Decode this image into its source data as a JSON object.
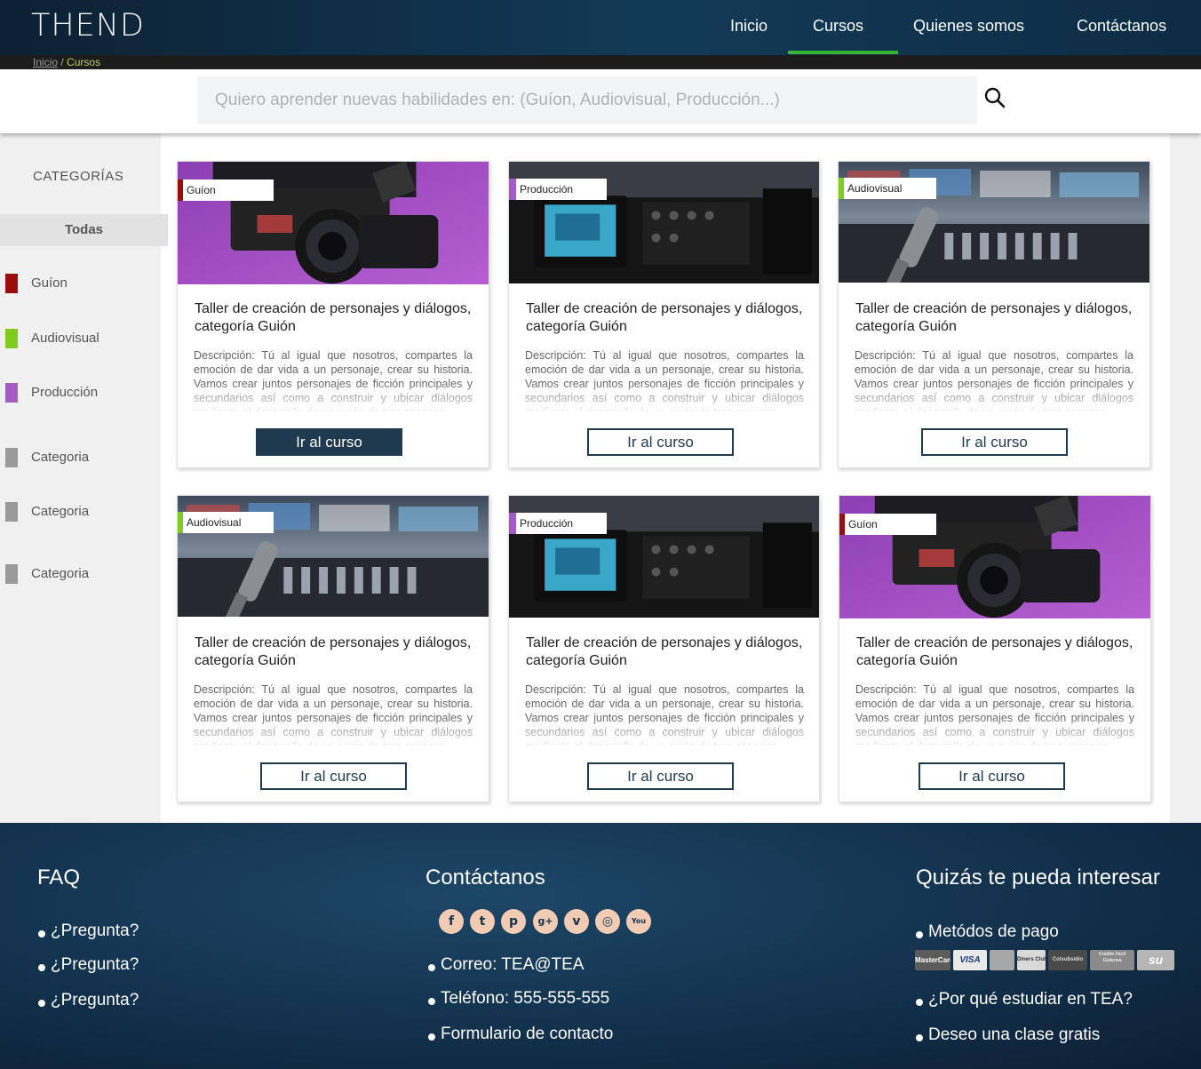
{
  "header": {
    "logo": "THEND",
    "nav": [
      "Inicio",
      "Cursos",
      "Quienes somos",
      "Contáctanos"
    ],
    "active_nav": "Cursos"
  },
  "breadcrumb": {
    "home": "Inicio",
    "separator": " / ",
    "current": "Cursos"
  },
  "search": {
    "placeholder": "Quiero aprender nuevas habilidades en: (Guíon, Audiovisual, Producción...)"
  },
  "sidebar": {
    "title": "CATEGORÍAS",
    "all": "Todas",
    "items": [
      {
        "label": "Guíon",
        "color": "#9b0d0d"
      },
      {
        "label": "Audiovisual",
        "color": "#7fcc1f"
      },
      {
        "label": "Producción",
        "color": "#a45bc4"
      },
      {
        "label": "Categoria",
        "color": "#9a9a9a"
      },
      {
        "label": "Categoria",
        "color": "#9a9a9a"
      },
      {
        "label": "Categoria",
        "color": "#9a9a9a"
      }
    ]
  },
  "colors": {
    "guion": "#9b0d0d",
    "audiovisual": "#7fcc1f",
    "produccion": "#a45bc4",
    "button": "#1f3a4f",
    "nav_accent": "#36b52e"
  },
  "cards": [
    {
      "tag": "Guíon",
      "image": "camera-purple",
      "title": "Taller de creación de personajes y diálogos, categoría Guión",
      "description": "Descripción: Tú al igual que nosotros, compartes la emoción de dar vida a un personaje, crear su historia. Vamos crear juntos personajes de ficción principales y secundarios así como a construir y ubicar diálogos mediante el desarrollo de un guión de tres escenas.",
      "button": "Ir al curso"
    },
    {
      "tag": "Producción",
      "image": "camera-screen",
      "title": "Taller de creación de personajes y diálogos, categoría Guión",
      "description": "Descripción: Tú al igual que nosotros, compartes la emoción de dar vida a un personaje, crear su historia. Vamos crear juntos personajes de ficción principales y secundarios así como a construir y ubicar diálogos mediante el desarrollo de un guión de tres escenas.",
      "button": "Ir al curso"
    },
    {
      "tag": "Audiovisual",
      "image": "studio-mic",
      "title": "Taller de creación de personajes y diálogos, categoría Guión",
      "description": "Descripción: Tú al igual que nosotros, compartes la emoción de dar vida a un personaje, crear su historia. Vamos crear juntos personajes de ficción principales y secundarios así como a construir y ubicar diálogos mediante el desarrollo de un guión de tres escenas.",
      "button": "Ir al curso"
    },
    {
      "tag": "Audiovisual",
      "image": "studio-mic",
      "title": "Taller de creación de personajes y diálogos, categoría Guión",
      "description": "Descripción: Tú al igual que nosotros, compartes la emoción de dar vida a un personaje, crear su historia. Vamos crear juntos personajes de ficción principales y secundarios así como a construir y ubicar diálogos mediante el desarrollo de un guión de tres escenas.",
      "button": "Ir al curso"
    },
    {
      "tag": "Producción",
      "image": "camera-screen",
      "title": "Taller de creación de personajes y diálogos, categoría Guión",
      "description": "Descripción: Tú al igual que nosotros, compartes la emoción de dar vida a un personaje, crear su historia. Vamos crear juntos personajes de ficción principales y secundarios así como a construir y ubicar diálogos mediante el desarrollo de un guión de tres escenas.",
      "button": "Ir al curso"
    },
    {
      "tag": "Guíon",
      "image": "camera-purple",
      "title": "Taller de creación de personajes y diálogos, categoría Guión",
      "description": "Descripción: Tú al igual que nosotros, compartes la emoción de dar vida a un personaje, crear su historia. Vamos crear juntos personajes de ficción principales y secundarios así como a construir y ubicar diálogos mediante el desarrollo de un guión de tres escenas.",
      "button": "Ir al curso"
    }
  ],
  "footer": {
    "faq": {
      "title": "FAQ",
      "items": [
        "¿Pregunta?",
        "¿Pregunta?",
        "¿Pregunta?"
      ]
    },
    "contact": {
      "title": "Contáctanos",
      "social": [
        "facebook-icon",
        "twitter-icon",
        "pinterest-icon",
        "google-plus-icon",
        "vimeo-icon",
        "instagram-icon",
        "youtube-icon"
      ],
      "social_glyphs": [
        "f",
        "t",
        "p",
        "g+",
        "v",
        "◎",
        "You"
      ],
      "items": [
        "Correo: TEA@TEA",
        "Teléfono: 555-555-555",
        "Formulario de contacto"
      ]
    },
    "interest": {
      "title": "Quizás te pueda interesar",
      "items": [
        "Metódos de pago",
        "¿Por qué estudiar en TEA?",
        "Deseo una clase gratis"
      ],
      "payments": [
        "MasterCard",
        "VISA",
        "",
        "Diners Club",
        "Colsubsidio",
        "Crédito Fácil Codensa",
        "su"
      ]
    }
  }
}
